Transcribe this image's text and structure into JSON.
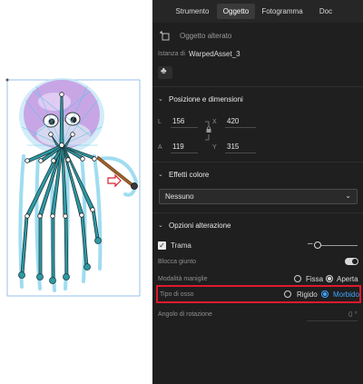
{
  "tabs": [
    {
      "label": "Strumento",
      "active": false
    },
    {
      "label": "Oggetto",
      "active": true
    },
    {
      "label": "Fotogramma",
      "active": false
    },
    {
      "label": "Doc",
      "active": false
    }
  ],
  "object": {
    "type_label": "Oggetto alterato",
    "instance_label": "Istanza di",
    "instance_value": "WarpedAsset_3"
  },
  "position": {
    "header": "Posizione e dimensioni",
    "l_label": "L",
    "l_value": "156",
    "x_label": "X",
    "x_value": "420",
    "a_label": "A",
    "a_value": "119",
    "y_label": "Y",
    "y_value": "315"
  },
  "color_effects": {
    "header": "Effetti colore",
    "selected": "Nessuno"
  },
  "warp_options": {
    "header": "Opzioni alterazione",
    "mesh_label": "Trama",
    "mesh_checked": true,
    "lock_joint_label": "Blocca giunto",
    "lock_joint_on": true,
    "handle_mode_label": "Modalità maniglie",
    "handle_fixed": "Fissa",
    "handle_open": "Aperta",
    "handle_selected": "Aperta",
    "bone_type_label": "Tipo di osso",
    "bone_rigid": "Rigido",
    "bone_soft": "Morbido",
    "bone_selected": "Morbido",
    "rotation_label": "Angolo di rotazione",
    "rotation_value": "0 °"
  },
  "colors": {
    "panel_bg": "#1f1f1f",
    "highlight": "#e0182d",
    "accent_blue": "#3ea6ff",
    "bone": "#2b8c95",
    "jellyfish_head": "#c9a7e8"
  }
}
